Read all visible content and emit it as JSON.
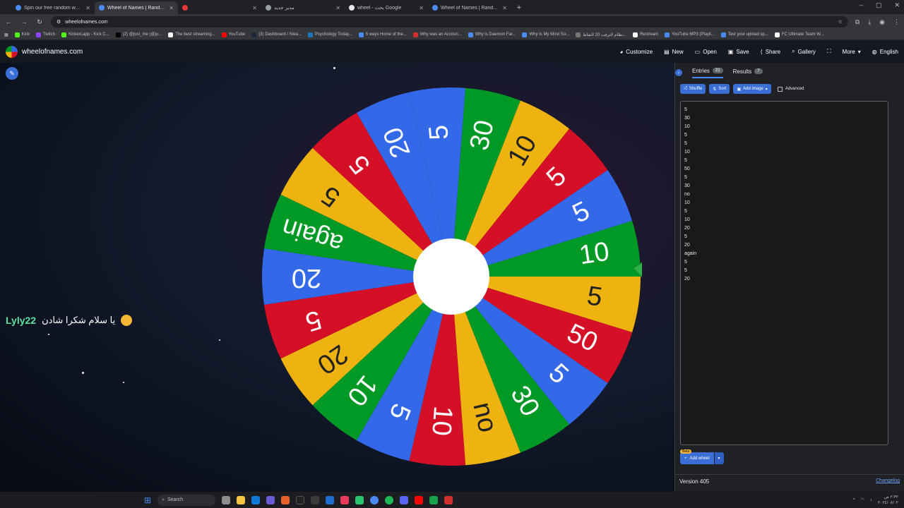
{
  "browser": {
    "tabs": [
      {
        "title": "Spin our free random wheel fo",
        "active": false,
        "color": "#4c8bf5"
      },
      {
        "title": "Wheel of Names | Random nam",
        "active": true,
        "color": "#4c8bf5"
      },
      {
        "title": "",
        "active": false,
        "color": "#e53935"
      },
      {
        "title": "مدير جديد",
        "active": false,
        "color": "#9aa0a6"
      },
      {
        "title": "wheel - بحث Google",
        "active": false,
        "color": "#e8eaed"
      },
      {
        "title": "Wheel of Names | Random nam",
        "active": false,
        "color": "#4c8bf5"
      }
    ],
    "url": "wheelofnames.com",
    "bookmarks": [
      "Kick",
      "Twitch",
      "KickerLapp - Kick C...",
      "(2) @just_me (@ju...",
      "The best streaming...",
      "YouTube",
      "(3) Dashboard / Stea...",
      "Psychology Today...",
      "5 ways Home of the...",
      "Why was an Accoun...",
      "Why is Daemon Far...",
      "Why Is My Mind So...",
      "نظام الترقب 20 التقاط...",
      "Restream",
      "YouTube MP3 (Playli...",
      "Test your upload sp...",
      "FC Ultimate Team W..."
    ]
  },
  "site": {
    "name": "wheelofnames.com",
    "menu": [
      "Customize",
      "New",
      "Open",
      "Save",
      "Share",
      "Gallery",
      "",
      "More",
      "English"
    ]
  },
  "chat": {
    "user": "Lyly22",
    "message": "يا سلام شكرا شادن"
  },
  "chart_data": {
    "type": "pie",
    "segments": [
      "5",
      "30",
      "10",
      "5",
      "5",
      "10",
      "5",
      "50",
      "5",
      "30",
      "no",
      "10",
      "5",
      "10",
      "20",
      "5",
      "20",
      "again",
      "5",
      "5",
      "20"
    ],
    "colors": [
      "#3369e8",
      "#009925",
      "#eeb211",
      "#d50f25"
    ],
    "start_angle_deg": -102.86
  },
  "panel": {
    "tabs": [
      {
        "label": "Entries",
        "count": "21"
      },
      {
        "label": "Results",
        "count": "7"
      }
    ],
    "buttons": {
      "shuffle": "Shuffle",
      "sort": "Sort",
      "add_image": "Add image",
      "advanced": "Advanced"
    },
    "entries": [
      "5",
      "30",
      "10",
      "5",
      "5",
      "10",
      "5",
      "50",
      "5",
      "30",
      "no",
      "10",
      "5",
      "10",
      "20",
      "5",
      "20",
      "again",
      "5",
      "5",
      "20"
    ],
    "beta": "Beta",
    "add_wheel": "Add wheel",
    "version": "Version 405",
    "changelog": "Changelog"
  },
  "taskbar": {
    "search": "Search",
    "time": "٢:٣٢ ص",
    "date": "٢٠٢٤/٠٨/٠٢"
  }
}
